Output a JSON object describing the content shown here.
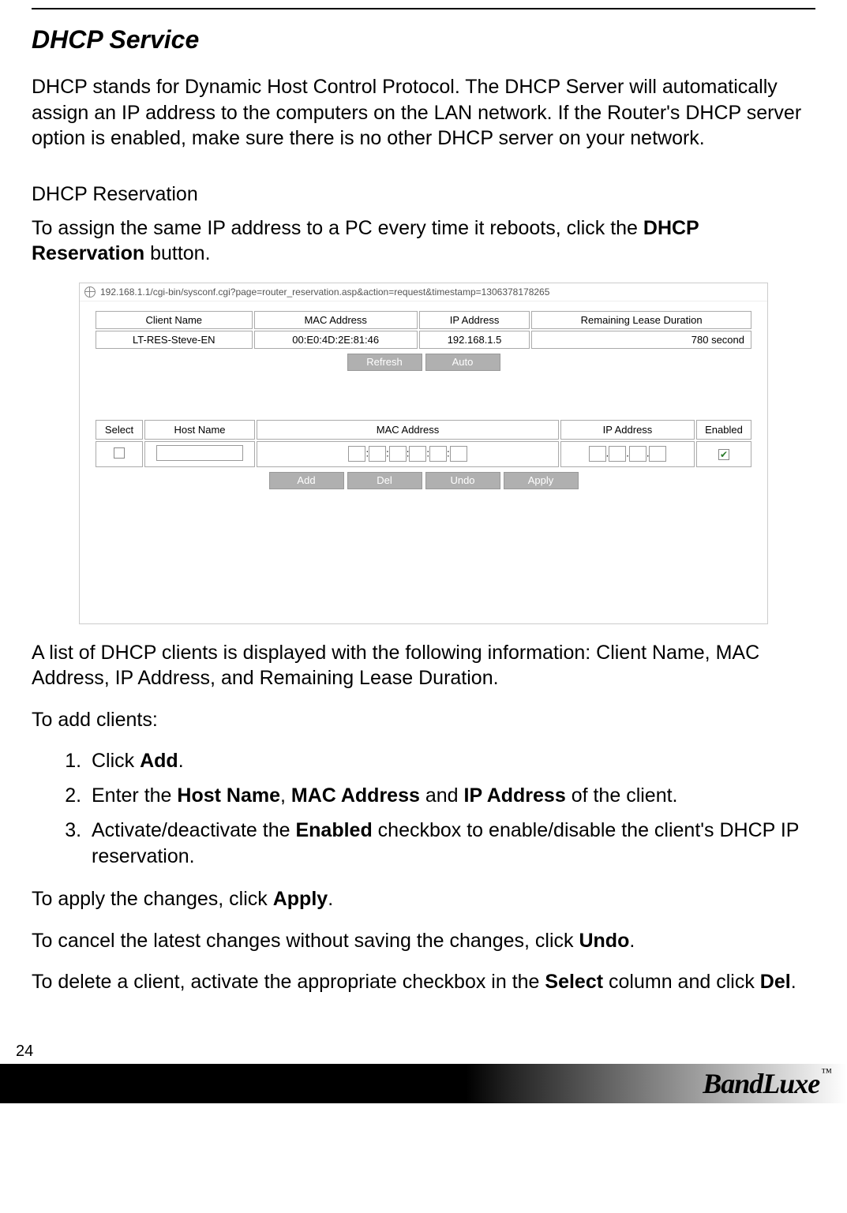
{
  "title": "DHCP Service",
  "intro": "DHCP stands for Dynamic Host Control Protocol. The DHCP Server will automatically assign an IP address to the computers on the LAN network. If the Router's DHCP server option is enabled, make sure there is no other DHCP server on your network.",
  "sub_heading": "DHCP Reservation",
  "sub_intro_a": "To assign the same IP address to a PC every time it reboots, click the ",
  "sub_intro_b": "DHCP Reservation",
  "sub_intro_c": " button.",
  "url": "192.168.1.1/cgi-bin/sysconf.cgi?page=router_reservation.asp&action=request&timestamp=1306378178265",
  "table1_headers": [
    "Client Name",
    "MAC Address",
    "IP Address",
    "Remaining Lease Duration"
  ],
  "table1_row": [
    "LT-RES-Steve-EN",
    "00:E0:4D:2E:81:46",
    "192.168.1.5",
    "780 second"
  ],
  "buttons1": [
    "Refresh",
    "Auto"
  ],
  "table2_headers": [
    "Select",
    "Host Name",
    "MAC Address",
    "IP Address",
    "Enabled"
  ],
  "buttons2": [
    "Add",
    "Del",
    "Undo",
    "Apply"
  ],
  "after1": "A list of DHCP clients is displayed with the following information: Client Name, MAC Address, IP Address, and Remaining Lease Duration.",
  "after2": "To add clients:",
  "steps": {
    "s1a": "Click ",
    "s1b": "Add",
    "s1c": ".",
    "s2a": "Enter the ",
    "s2b": "Host Name",
    "s2c": ", ",
    "s2d": "MAC Address",
    "s2e": " and ",
    "s2f": "IP Address",
    "s2g": " of the client.",
    "s3a": "Activate/deactivate the ",
    "s3b": "Enabled",
    "s3c": " checkbox to enable/disable the client's DHCP IP reservation."
  },
  "apply_a": "To apply the changes, click ",
  "apply_b": "Apply",
  "apply_c": ".",
  "undo_a": "To cancel the latest changes without saving the changes, click ",
  "undo_b": "Undo",
  "undo_c": ".",
  "del_a": "To delete a client, activate the appropriate checkbox in the ",
  "del_b": "Select",
  "del_c": " column and click ",
  "del_d": "Del",
  "del_e": ".",
  "page_number": "24",
  "brand": "BandLuxe",
  "tm": "™"
}
